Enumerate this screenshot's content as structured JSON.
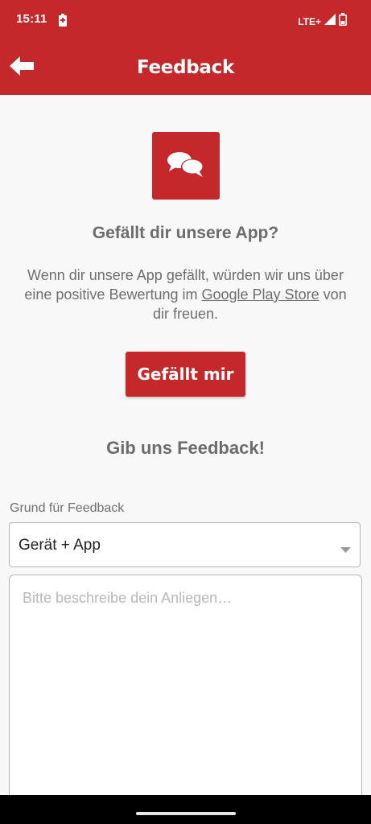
{
  "status_bar": {
    "time": "15:11",
    "network": "LTE+"
  },
  "app_bar": {
    "title": "Feedback"
  },
  "icons": {
    "back": "arrow-left-icon",
    "tile": "chat-bubbles-icon",
    "dropdown": "caret-down-icon"
  },
  "colors": {
    "brand_red": "#c4282b",
    "background": "#f8f8f8",
    "text_gray": "#6e6e6e"
  },
  "rating_section": {
    "heading": "Gefällt dir unsere App?",
    "text_before_link": "Wenn dir unsere App gefällt, würden wir uns über eine positive Bewertung im ",
    "link_text": "Google Play Store",
    "text_after_link": " von dir freuen.",
    "button_label": "Gefällt mir"
  },
  "feedback_section": {
    "heading": "Gib uns Feedback!",
    "reason_label": "Grund für Feedback",
    "reason_value": "Gerät + App",
    "message_placeholder": "Bitte beschreibe dein Anliegen…"
  }
}
